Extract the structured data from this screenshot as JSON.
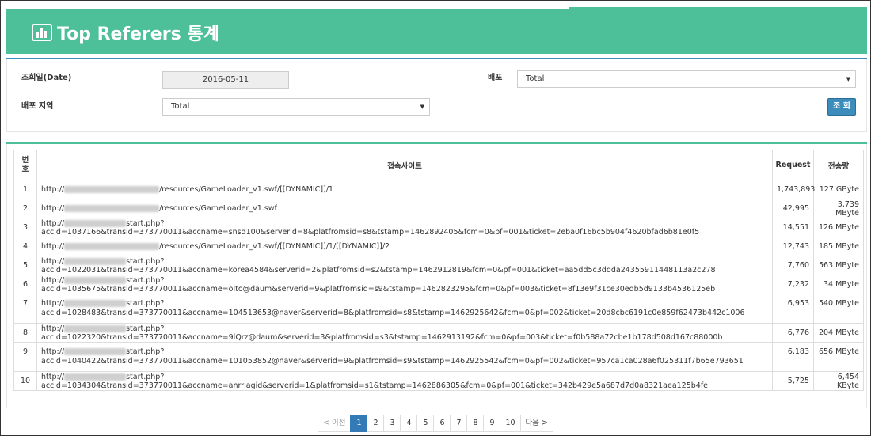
{
  "header": {
    "title": "Top Referers 통계",
    "icon": "bar-chart-icon"
  },
  "filters": {
    "date_label": "조회일(Date)",
    "date_value": "2016-05-11",
    "dist_label": "배포",
    "dist_value": "Total",
    "region_label": "배포 지역",
    "region_value": "Total",
    "search_button": "조 회"
  },
  "table": {
    "headers": {
      "no": "번호",
      "site": "접속사이트",
      "request": "Request",
      "transfer": "전송량"
    },
    "rows": [
      {
        "no": "1",
        "pre": "http://",
        "post": "/resources/GameLoader_v1.swf/[[DYNAMIC]]/1",
        "post2": "",
        "request": "1,743,893",
        "transfer": "127 GByte"
      },
      {
        "no": "2",
        "pre": "http://",
        "post": "/resources/GameLoader_v1.swf",
        "post2": "",
        "request": "42,995",
        "transfer": "3,739 MByte"
      },
      {
        "no": "3",
        "pre": "http://",
        "post": "start.php?accid=1037166&transid=373770011&accname=snsd100&serverid=8&platfromsid=s8&tstamp=1462892405&fcm=0&pf=001&ticket=2eba0f16bc5b904f4620bfad6b81e0f5",
        "post2": "",
        "request": "14,551",
        "transfer": "126 MByte"
      },
      {
        "no": "4",
        "pre": "http://",
        "post": "/resources/GameLoader_v1.swf/[[DYNAMIC]]/1/[[DYNAMIC]]/2",
        "post2": "",
        "request": "12,743",
        "transfer": "185 MByte"
      },
      {
        "no": "5",
        "pre": "http://",
        "post": "start.php?accid=1022031&transid=373770011&accname=korea4584&serverid=2&platfromsid=s2&tstamp=1462912819&fcm=0&pf=001&ticket=aa5dd5c3ddda24355911448113a2c278",
        "post2": "",
        "request": "7,760",
        "transfer": "563 MByte"
      },
      {
        "no": "6",
        "pre": "http://",
        "post": "start.php?accid=1035675&transid=373770011&accname=olto@daum&serverid=9&platfromsid=s9&tstamp=1462823295&fcm=0&pf=003&ticket=8f13e9f31ce30edb5d9133b4536125eb",
        "post2": "",
        "request": "7,232",
        "transfer": "34 MByte"
      },
      {
        "no": "7",
        "pre": "http://",
        "post": "start.php?",
        "post2": "accid=1028483&transid=373770011&accname=104513653@naver&serverid=8&platfromsid=s8&tstamp=1462925642&fcm=0&pf=002&ticket=20d8cbc6191c0e859f62473b442c1006",
        "request": "6,953",
        "transfer": "540 MByte"
      },
      {
        "no": "8",
        "pre": "http://",
        "post": "start.php?accid=1022320&transid=373770011&accname=9lQrz@daum&serverid=3&platfromsid=s3&tstamp=1462913192&fcm=0&pf=003&ticket=f0b588a72cbe1b178d508d167c88000b",
        "post2": "",
        "request": "6,776",
        "transfer": "204 MByte"
      },
      {
        "no": "9",
        "pre": "http://",
        "post": "start.php?",
        "post2": "accid=1040422&transid=373770011&accname=101053852@naver&serverid=9&platfromsid=s9&tstamp=1462925542&fcm=0&pf=002&ticket=957ca1ca028a6f025311f7b65e793651",
        "request": "6,183",
        "transfer": "656 MByte"
      },
      {
        "no": "10",
        "pre": "http://",
        "post": "start.php?accid=1034304&transid=373770011&accname=anrrjagid&serverid=1&platfromsid=s1&tstamp=1462886305&fcm=0&pf=001&ticket=342b429e5a687d7d0a8321aea125b4fe",
        "post2": "",
        "request": "5,725",
        "transfer": "6,454 KByte"
      }
    ]
  },
  "pagination": {
    "prev": "< 이전",
    "pages": [
      "1",
      "2",
      "3",
      "4",
      "5",
      "6",
      "7",
      "8",
      "9",
      "10"
    ],
    "active": "1",
    "next": "다음 >"
  }
}
